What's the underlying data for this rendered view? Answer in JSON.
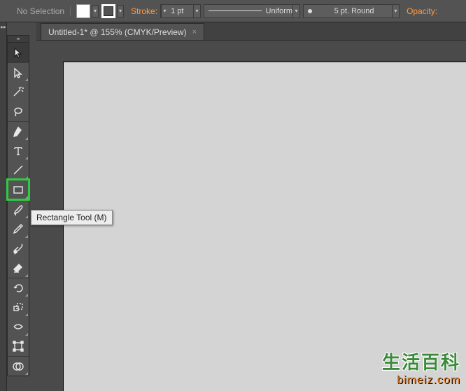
{
  "options_bar": {
    "selection_status": "No Selection",
    "stroke_label": "Stroke:",
    "stroke_weight": "1 pt",
    "stroke_profile": "Uniform",
    "brush_preset": "5 pt. Round",
    "opacity_label": "Opacity:"
  },
  "document": {
    "tab_title": "Untitled-1* @ 155% (CMYK/Preview)"
  },
  "tooltip": {
    "text": "Rectangle Tool (M)"
  },
  "tools": [
    {
      "name": "selection-tool",
      "hasMenu": false
    },
    {
      "name": "direct-selection-tool",
      "hasMenu": true
    },
    {
      "name": "magic-wand-tool",
      "hasMenu": false
    },
    {
      "name": "lasso-tool",
      "hasMenu": false
    },
    {
      "name": "pen-tool",
      "hasMenu": true
    },
    {
      "name": "type-tool",
      "hasMenu": true
    },
    {
      "name": "line-segment-tool",
      "hasMenu": true
    },
    {
      "name": "rectangle-tool",
      "hasMenu": true,
      "highlighted": true
    },
    {
      "name": "paintbrush-tool",
      "hasMenu": true
    },
    {
      "name": "pencil-tool",
      "hasMenu": true
    },
    {
      "name": "blob-brush-tool",
      "hasMenu": false
    },
    {
      "name": "eraser-tool",
      "hasMenu": true
    },
    {
      "name": "rotate-tool",
      "hasMenu": true
    },
    {
      "name": "scale-tool",
      "hasMenu": true
    },
    {
      "name": "width-tool",
      "hasMenu": true
    },
    {
      "name": "free-transform-tool",
      "hasMenu": false
    },
    {
      "name": "shape-builder-tool",
      "hasMenu": true
    },
    {
      "name": "more-tool-1",
      "hasMenu": true
    },
    {
      "name": "more-tool-2",
      "hasMenu": true
    }
  ],
  "watermark": {
    "line1": "生活百科",
    "line2": "bimeiz.com"
  }
}
